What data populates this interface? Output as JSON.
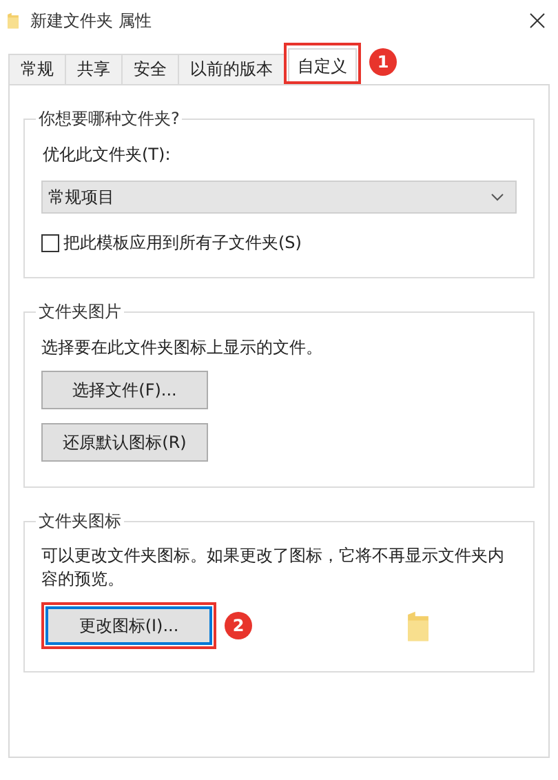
{
  "window": {
    "title": "新建文件夹 属性"
  },
  "tabs": [
    {
      "label": "常规",
      "selected": false
    },
    {
      "label": "共享",
      "selected": false
    },
    {
      "label": "安全",
      "selected": false
    },
    {
      "label": "以前的版本",
      "selected": false
    },
    {
      "label": "自定义",
      "selected": true,
      "marker": "1"
    }
  ],
  "folder_type": {
    "title": "你想要哪种文件夹?",
    "label": "优化此文件夹(T):",
    "value": "常规项目",
    "apply_to_subfolders": {
      "label": "把此模板应用到所有子文件夹(S)",
      "checked": false
    }
  },
  "folder_pictures": {
    "title": "文件夹图片",
    "description": "选择要在此文件夹图标上显示的文件。",
    "buttons": [
      {
        "label": "选择文件(F)..."
      },
      {
        "label": "还原默认图标(R)"
      }
    ]
  },
  "folder_icons": {
    "title": "文件夹图标",
    "description": "可以更改文件夹图标。如果更改了图标，它将不再显示文件夹内容的预览。",
    "button": {
      "label": "更改图标(I)...",
      "focused": true,
      "marker": "2"
    }
  }
}
